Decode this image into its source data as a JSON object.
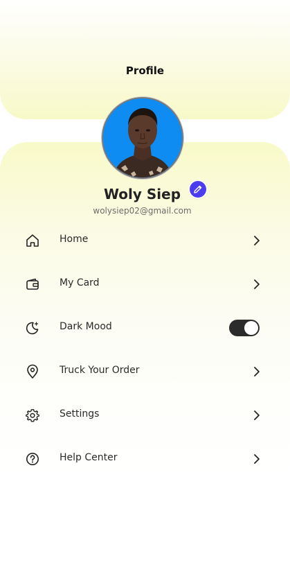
{
  "header": {
    "title": "Profile"
  },
  "profile": {
    "name": "Woly Siep",
    "email": "wolysiep02@gmail.com"
  },
  "menu": {
    "items": [
      {
        "label": "Home",
        "icon": "home-icon",
        "control": "chevron"
      },
      {
        "label": "My Card",
        "icon": "wallet-icon",
        "control": "chevron"
      },
      {
        "label": "Dark Mood",
        "icon": "moon-icon",
        "control": "toggle",
        "toggle_on": true
      },
      {
        "label": "Truck Your Order",
        "icon": "location-pin-icon",
        "control": "chevron"
      },
      {
        "label": "Settings",
        "icon": "gear-icon",
        "control": "chevron"
      },
      {
        "label": "Help Center",
        "icon": "help-icon",
        "control": "chevron"
      }
    ]
  },
  "colors": {
    "header_bg": "#f8f9c8",
    "edit_button": "#4b3cf0",
    "avatar_bg": "#0f8cf2",
    "toggle_track": "#2b2b2b"
  }
}
